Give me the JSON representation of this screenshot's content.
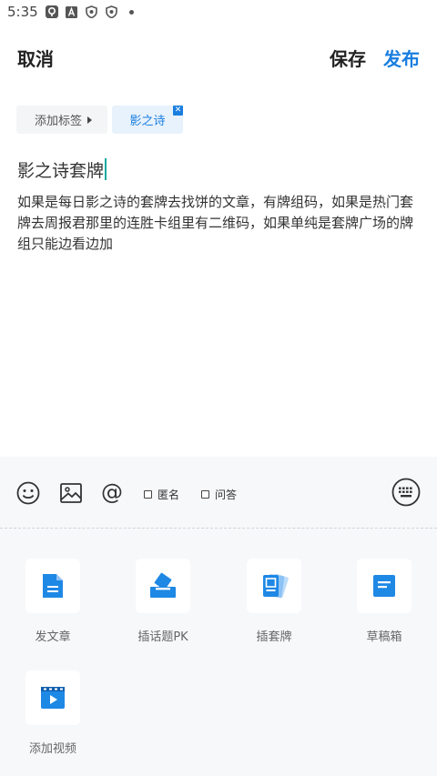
{
  "status_bar": {
    "time": "5:35",
    "icons": [
      "app-notification-icon",
      "a-badge-icon",
      "shield-icon",
      "shield-icon",
      "more-dot"
    ]
  },
  "header": {
    "cancel_label": "取消",
    "save_label": "保存",
    "publish_label": "发布"
  },
  "tags": {
    "add_label": "添加标签",
    "items": [
      {
        "label": "影之诗"
      }
    ]
  },
  "post": {
    "title": "影之诗套牌",
    "body": "如果是每日影之诗的套牌去找饼的文章，有牌组码，如果是热门套牌去周报君那里的连胜卡组里有二维码，如果单纯是套牌广场的牌组只能边看边加"
  },
  "toolbar": {
    "anonymous_label": "匿名",
    "qa_label": "问答"
  },
  "panel": {
    "items": [
      {
        "label": "发文章",
        "icon": "document-icon"
      },
      {
        "label": "插话题PK",
        "icon": "vote-box-icon"
      },
      {
        "label": "插套牌",
        "icon": "card-deck-icon"
      },
      {
        "label": "草稿箱",
        "icon": "drafts-icon"
      },
      {
        "label": "添加视频",
        "icon": "video-icon"
      }
    ]
  },
  "colors": {
    "accent": "#1a7ee0",
    "icon_blue": "#1e88e5",
    "cursor": "#1aa9a0",
    "panel_bg": "#f7f8fa"
  }
}
